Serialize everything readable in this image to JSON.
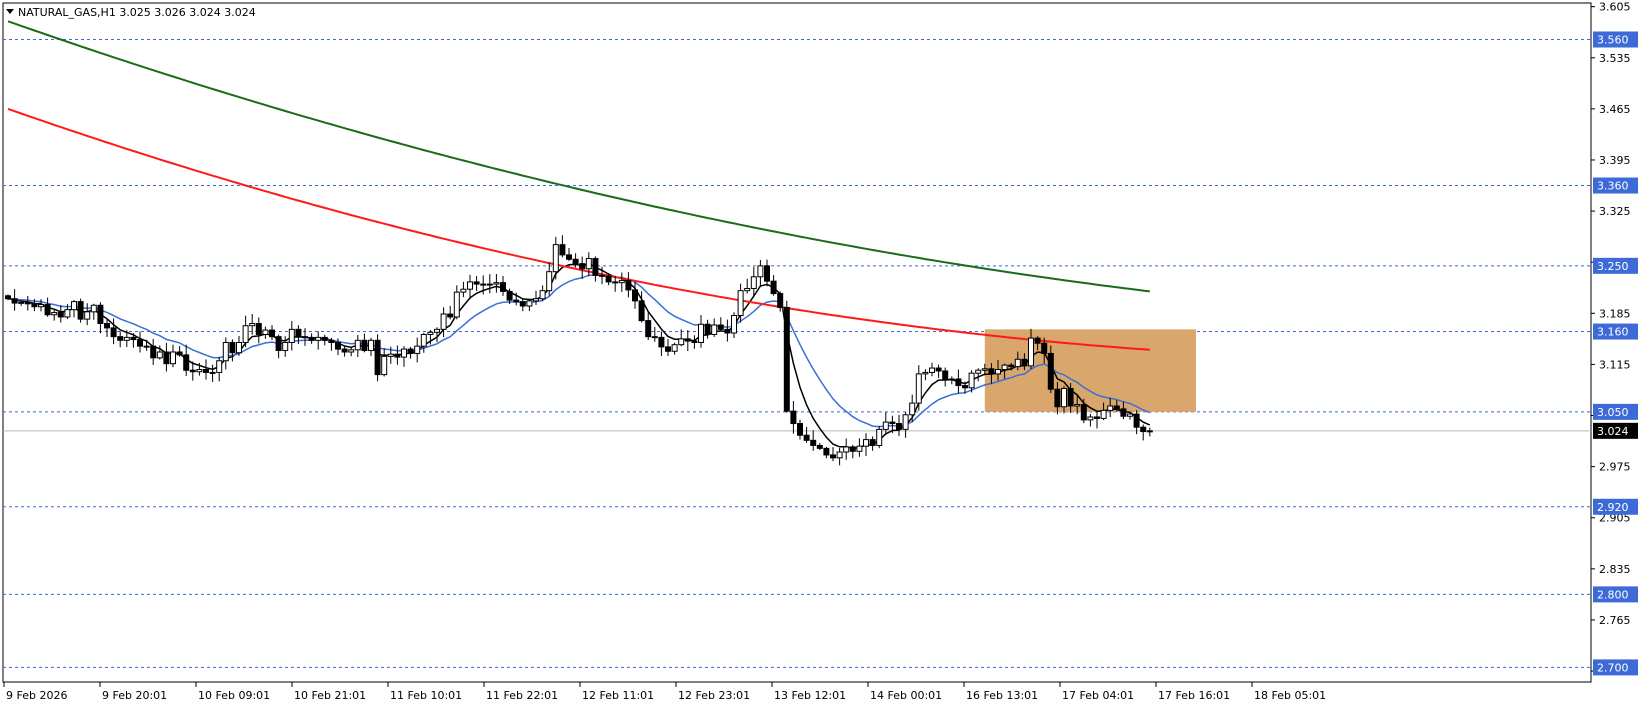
{
  "header": {
    "menu_icon": "triangle-down-icon",
    "text": "NATURAL_GAS,H1  3.025 3.026 3.024 3.024"
  },
  "colors": {
    "candle_up_fill": "#ffffff",
    "candle_down_fill": "#000000",
    "ma_fast": "#000000",
    "ma_mid": "#3a6fd8",
    "ma_slow": "#ff1a1a",
    "ma_long": "#1a6b1a",
    "level_line": "#3d6ad6",
    "level_badge": "#3d6ad6",
    "price_badge": "#000000",
    "zone_fill": "#d9a66b"
  },
  "chart_data": {
    "type": "candlestick",
    "symbol": "NATURAL_GAS",
    "timeframe": "H1",
    "last_ohlc": {
      "open": 3.025,
      "high": 3.026,
      "low": 3.024,
      "close": 3.024
    },
    "current_price": "3.024",
    "ylim": [
      2.68,
      3.61
    ],
    "y_ticks": [
      "3.605",
      "3.535",
      "3.465",
      "3.395",
      "3.325",
      "3.255",
      "3.185",
      "3.115",
      "3.045",
      "2.975",
      "2.905",
      "2.835",
      "2.765",
      "2.695"
    ],
    "x_ticks": [
      "9 Feb 2026",
      "9 Feb 20:01",
      "10 Feb 09:01",
      "10 Feb 21:01",
      "11 Feb 10:01",
      "11 Feb 22:01",
      "12 Feb 11:01",
      "12 Feb 23:01",
      "13 Feb 12:01",
      "14 Feb 00:01",
      "16 Feb 13:01",
      "17 Feb 04:01",
      "17 Feb 16:01",
      "18 Feb 05:01"
    ],
    "levels": [
      "3.560",
      "3.360",
      "3.250",
      "3.160",
      "3.050",
      "2.920",
      "2.800",
      "2.700"
    ],
    "zone": {
      "x_start": 148,
      "x_end": 180,
      "top": 3.163,
      "bottom": 3.05
    },
    "close_series": [
      3.205,
      3.199,
      3.2,
      3.198,
      3.194,
      3.197,
      3.183,
      3.186,
      3.18,
      3.19,
      3.201,
      3.177,
      3.187,
      3.196,
      3.171,
      3.165,
      3.153,
      3.148,
      3.152,
      3.149,
      3.14,
      3.14,
      3.124,
      3.132,
      3.116,
      3.132,
      3.128,
      3.107,
      3.105,
      3.108,
      3.104,
      3.104,
      3.12,
      3.145,
      3.131,
      3.145,
      3.168,
      3.171,
      3.156,
      3.162,
      3.153,
      3.134,
      3.145,
      3.163,
      3.153,
      3.152,
      3.148,
      3.152,
      3.148,
      3.145,
      3.136,
      3.132,
      3.135,
      3.148,
      3.134,
      3.148,
      3.101,
      3.126,
      3.129,
      3.125,
      3.136,
      3.13,
      3.14,
      3.156,
      3.159,
      3.163,
      3.184,
      3.18,
      3.214,
      3.218,
      3.228,
      3.225,
      3.224,
      3.225,
      3.227,
      3.215,
      3.203,
      3.201,
      3.195,
      3.202,
      3.205,
      3.216,
      3.242,
      3.279,
      3.265,
      3.259,
      3.253,
      3.246,
      3.26,
      3.237,
      3.236,
      3.228,
      3.227,
      3.23,
      3.217,
      3.202,
      3.175,
      3.153,
      3.152,
      3.139,
      3.133,
      3.142,
      3.15,
      3.147,
      3.145,
      3.17,
      3.156,
      3.169,
      3.163,
      3.158,
      3.182,
      3.216,
      3.219,
      3.235,
      3.25,
      3.229,
      3.212,
      3.193,
      3.051,
      3.034,
      3.018,
      3.011,
      3.004,
      3.0,
      2.991,
      2.987,
      2.995,
      3.002,
      2.996,
      3.003,
      3.012,
      3.004,
      3.026,
      3.036,
      3.034,
      3.026,
      3.046,
      3.062,
      3.102,
      3.104,
      3.11,
      3.106,
      3.094,
      3.095,
      3.086,
      3.083,
      3.103,
      3.107,
      3.109,
      3.102,
      3.108,
      3.114,
      3.112,
      3.122,
      3.113,
      3.151,
      3.144,
      3.13,
      3.081,
      3.057,
      3.082,
      3.058,
      3.06,
      3.039,
      3.043,
      3.041,
      3.052,
      3.058,
      3.054,
      3.044,
      3.047,
      3.029,
      3.023,
      3.024
    ]
  }
}
